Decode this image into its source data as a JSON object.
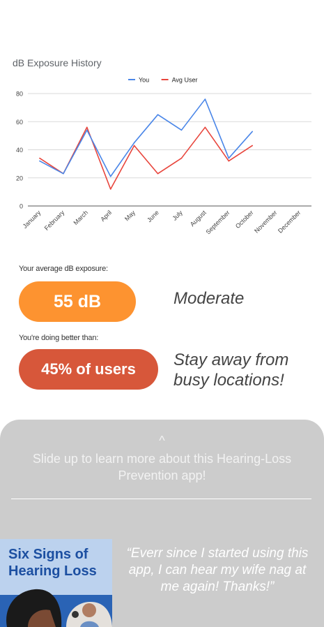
{
  "chart_data": {
    "type": "line",
    "title": "dB Exposure History",
    "xlabel": "",
    "ylabel": "",
    "categories": [
      "January",
      "February",
      "March",
      "April",
      "May",
      "June",
      "July",
      "August",
      "September",
      "October",
      "November",
      "December"
    ],
    "series": [
      {
        "name": "You",
        "color": "#4a86e8",
        "values": [
          32,
          23,
          54,
          21,
          45,
          65,
          54,
          76,
          34,
          53,
          null,
          null
        ]
      },
      {
        "name": "Avg User",
        "color": "#e8453c",
        "values": [
          34,
          23,
          56,
          12,
          43,
          23,
          34,
          56,
          32,
          43,
          null,
          null
        ]
      }
    ],
    "ylim": [
      0,
      80
    ],
    "yticks": [
      0,
      20,
      40,
      60,
      80
    ],
    "grid": true,
    "legend": "top-center"
  },
  "stats": {
    "avg_label": "Your average dB exposure:",
    "avg_value": "55 dB",
    "avg_status": "Moderate",
    "better_label": "You're doing better than:",
    "better_value": "45% of users",
    "better_advice": "Stay away from busy locations!"
  },
  "drawer": {
    "caret": "^",
    "prompt": "Slide up to learn more about this Hearing-Loss Prevention app!",
    "article_title": "Six Signs of Hearing Loss",
    "testimonial": "“Everr since I started using this app, I can hear my wife nag at me again! Thanks!”"
  },
  "colors": {
    "accent_orange": "#fd9330",
    "accent_red": "#d7573a",
    "drawer_bg": "#cccccc"
  }
}
